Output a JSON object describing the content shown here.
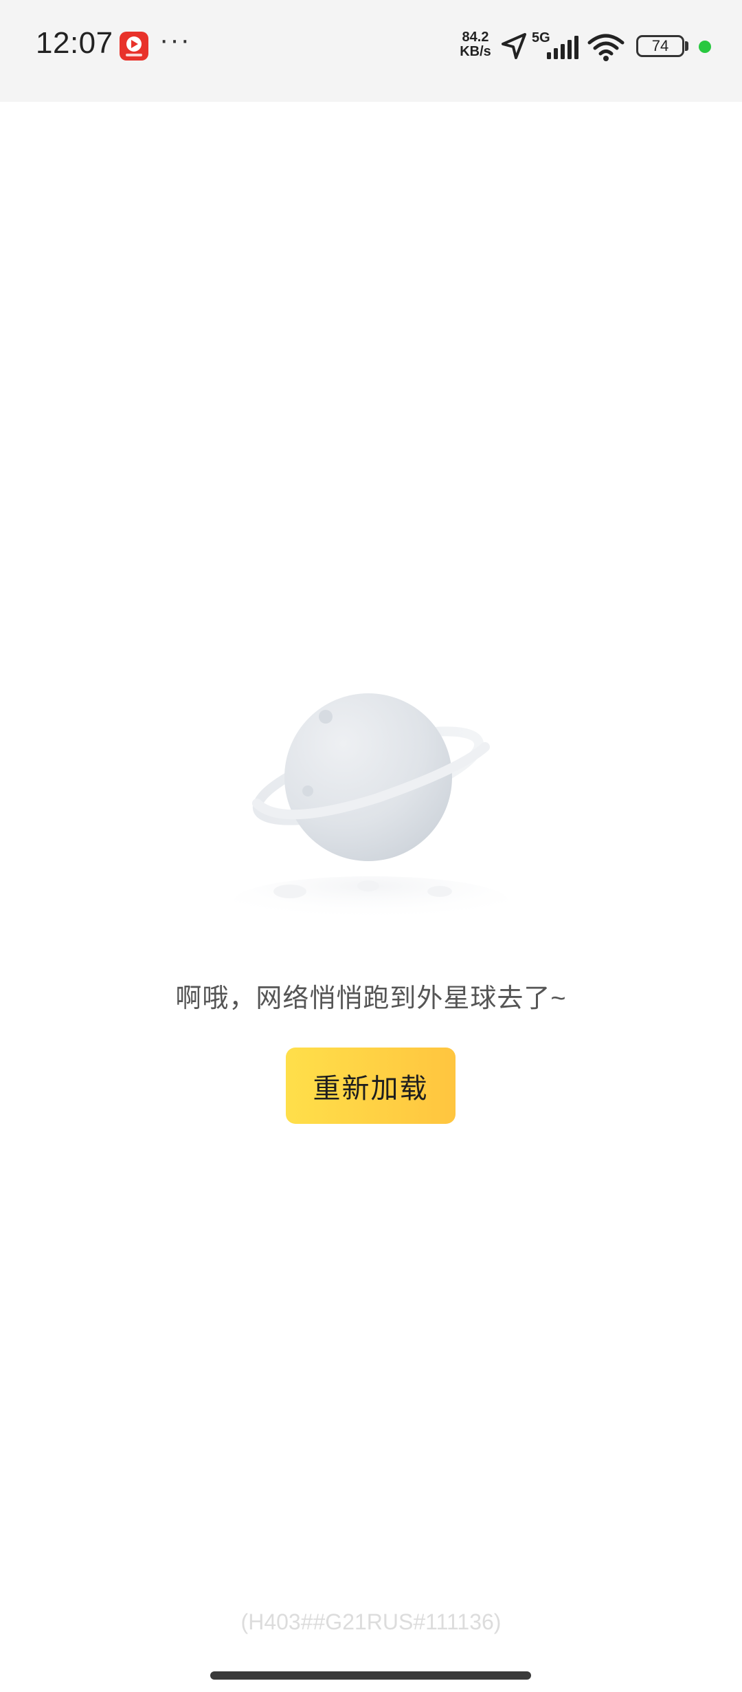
{
  "status_bar": {
    "time": "12:07",
    "more": "···",
    "net_speed_value": "84.2",
    "net_speed_unit": "KB/s",
    "network_type": "5G",
    "battery_level": "74",
    "icons": [
      "app-icon",
      "location-arrow-icon",
      "cellular-signal-icon",
      "wifi-icon",
      "battery-icon"
    ],
    "colors": {
      "background": "#f4f4f4",
      "app_icon": "#e8322a",
      "privacy_dot": "#28c840"
    }
  },
  "main": {
    "illustration": "planet-icon",
    "message": "啊哦，网络悄悄跑到外星球去了~",
    "reload_label": "重新加载",
    "error_code": "(H403##G21RUS#111136)",
    "colors": {
      "button_start": "#ffdf4a",
      "button_end": "#ffc53f",
      "message": "#555555",
      "error_code": "#dcdcdc"
    }
  }
}
